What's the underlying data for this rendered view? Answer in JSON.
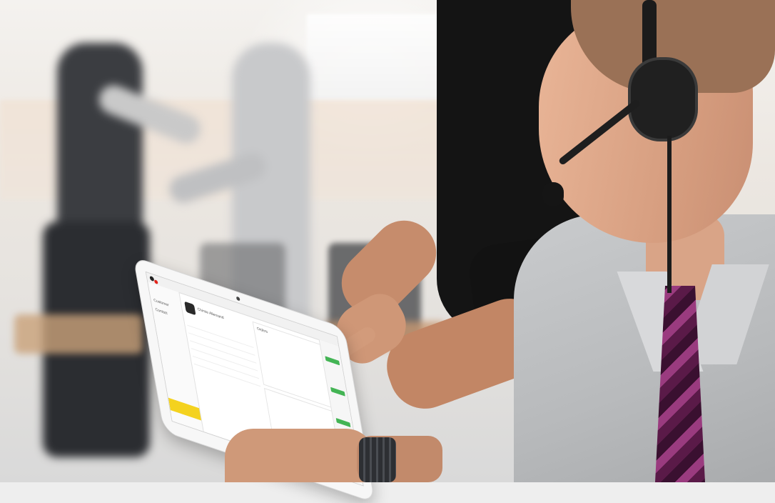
{
  "scene": {
    "description_elements": [
      "office-background",
      "person-walking",
      "person-black-shirt",
      "agent-with-headset",
      "tablet"
    ],
    "colors": {
      "tie": "#9a3b7f",
      "accent_green": "#43b454",
      "accent_yellow": "#f4d21f",
      "notification_red": "#e2231a"
    }
  },
  "tablet": {
    "screen_labels": {
      "profile_title": "Chimie Allemand",
      "menu_item": "Customer",
      "sub_item": "Contact",
      "section": "Orders"
    }
  }
}
